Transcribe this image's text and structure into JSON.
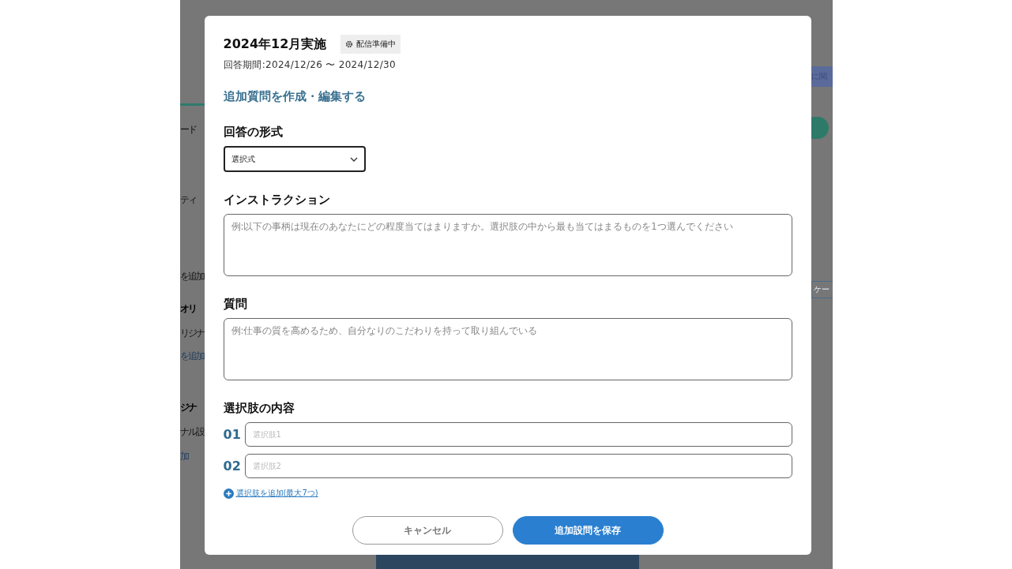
{
  "background": {
    "left_fragments": [
      {
        "text": "ード",
        "kind": "text"
      },
      {
        "text": "ティ",
        "kind": "text"
      },
      {
        "text": "を追加",
        "kind": "text"
      },
      {
        "text": "オリ",
        "kind": "heading"
      },
      {
        "text": "リジナ",
        "kind": "text"
      },
      {
        "text": "を追加",
        "kind": "link"
      },
      {
        "text": "ジナ",
        "kind": "heading"
      },
      {
        "text": "ナル設",
        "kind": "text"
      },
      {
        "text": "加",
        "kind": "link"
      }
    ],
    "right_fragments": [
      {
        "text": "に関",
        "kind": "banner"
      },
      {
        "text": "ケー",
        "kind": "outlined"
      }
    ]
  },
  "dialog": {
    "title": "2024年12月実施",
    "status_badge": "配信準備中",
    "period": "回答期間:2024/12/26 〜 2024/12/30",
    "heading": "追加質問を作成・編集する",
    "fields": [
      {
        "kind": "select",
        "label": "回答の形式",
        "value": "選択式"
      },
      {
        "kind": "textarea",
        "label": "インストラクション",
        "placeholder": "例:以下の事柄は現在のあなたにどの程度当てはまりますか。選択肢の中から最も当てはまるものを1つ選んでください"
      },
      {
        "kind": "textarea",
        "label": "質問",
        "placeholder": "例:仕事の質を高めるため、自分なりのこだわりを持って取り組んでいる"
      }
    ],
    "choices": {
      "label": "選択肢の内容",
      "items": [
        {
          "number": "01",
          "placeholder": "選択肢1"
        },
        {
          "number": "02",
          "placeholder": "選択肢2"
        }
      ],
      "add_link": "選択肢を追加(最大7つ)"
    },
    "buttons": [
      {
        "label": "キャンセル",
        "kind": "secondary"
      },
      {
        "label": "追加設問を保存",
        "kind": "primary"
      }
    ]
  }
}
